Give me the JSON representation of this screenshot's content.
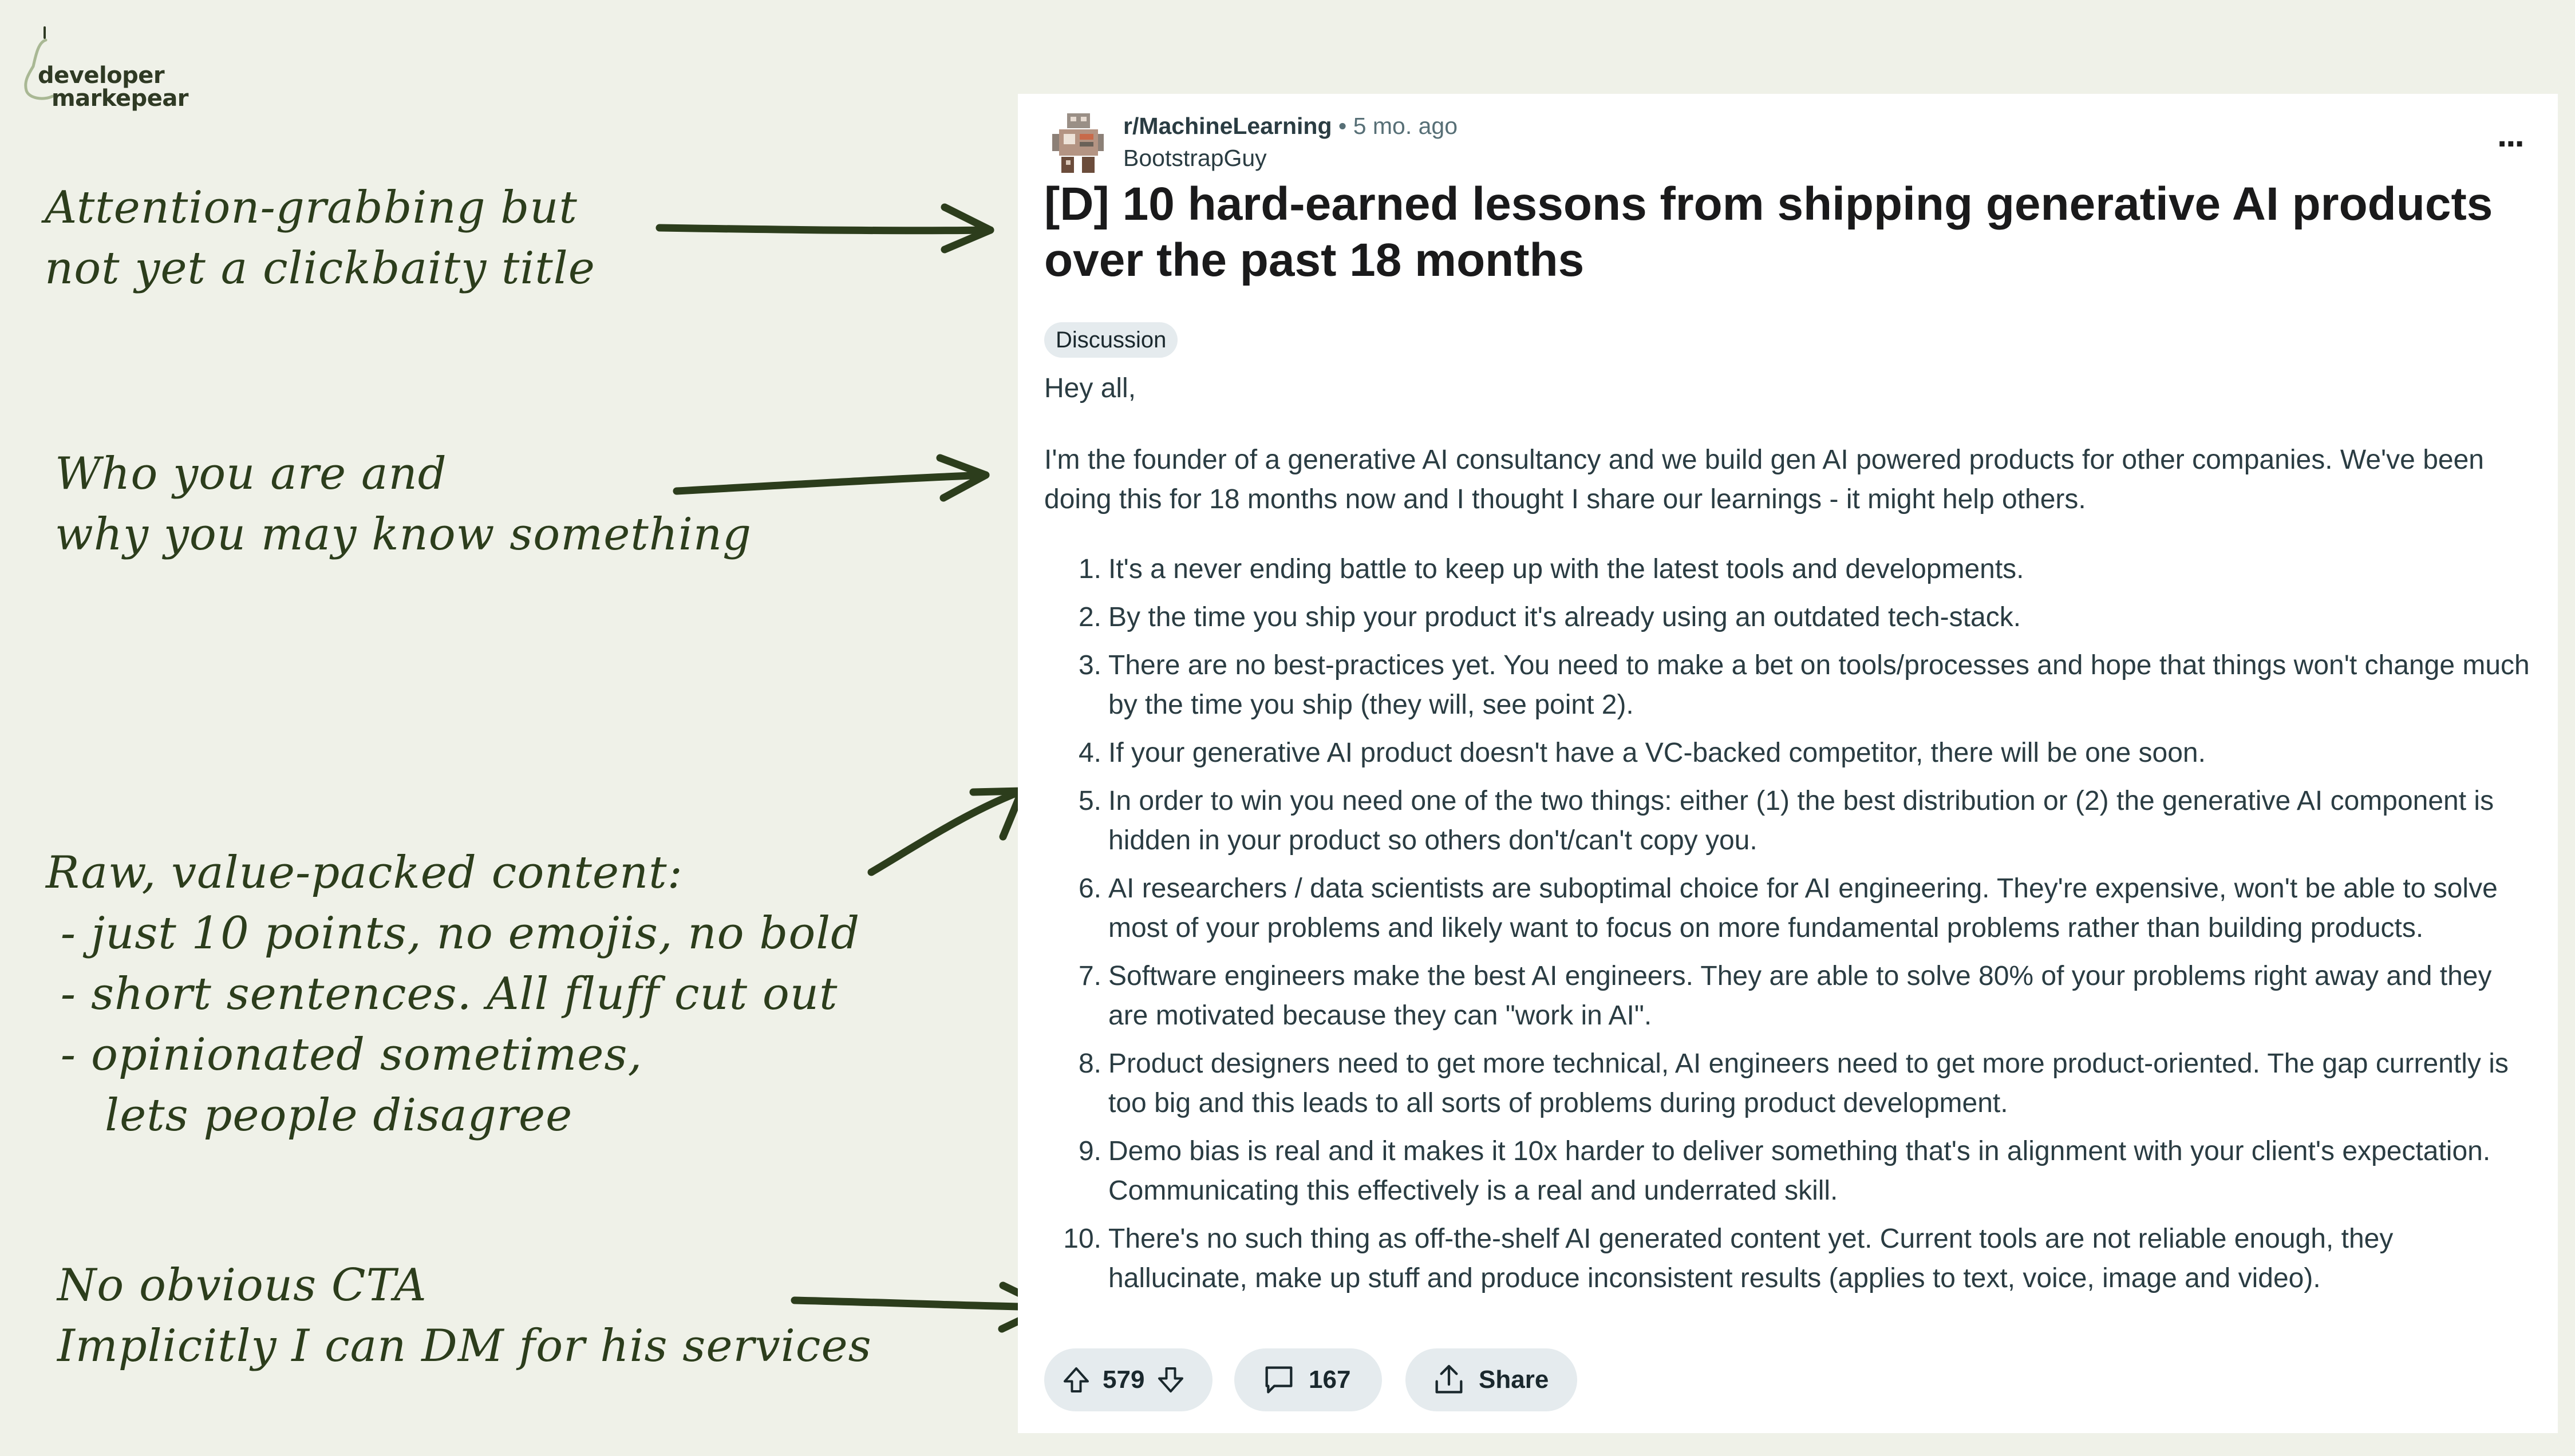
{
  "logo": {
    "line1": "developer",
    "line2": "markepear"
  },
  "annotations": {
    "title_note": "Attention-grabbing but\nnot yet a clickbaity title",
    "intro_note": "Who you are and\nwhy you may know something",
    "content_note": "Raw, value-packed content:\n - just 10 points, no emojis, no bold\n - short sentences. All fluff cut out\n - opinionated sometimes,\n    lets people disagree",
    "cta_note": "No obvious CTA\nImplicitly I can DM for his services"
  },
  "colors": {
    "background": "#eff1e8",
    "ink": "#2c3d1c",
    "card": "#ffffff",
    "pill": "#e5ebee"
  },
  "post": {
    "subreddit": "r/MachineLearning",
    "separator": "•",
    "age": "5 mo. ago",
    "author": "BootstrapGuy",
    "more_label": "...",
    "title": "[D] 10 hard-earned lessons from shipping generative AI products over the past 18 months",
    "flair": "Discussion",
    "greeting": "Hey all,",
    "intro": "I'm the founder of a generative AI consultancy and we build gen AI powered products for other companies. We've been doing this for 18 months now and I thought I share our learnings - it might help others.",
    "lessons": [
      {
        "num": "1.",
        "text": "It's a never ending battle to keep up with the latest tools and developments."
      },
      {
        "num": "2.",
        "text": "By the time you ship your product it's already using an outdated tech-stack."
      },
      {
        "num": "3.",
        "text": "There are no best-practices yet. You need to make a bet on tools/processes and hope that things won't change much by the time you ship (they will, see point 2)."
      },
      {
        "num": "4.",
        "text": "If your generative AI product doesn't have a VC-backed competitor, there will be one soon."
      },
      {
        "num": "5.",
        "text": "In order to win you need one of the two things: either (1) the best distribution or (2) the generative AI component is hidden in your product so others don't/can't copy you."
      },
      {
        "num": "6.",
        "text": "AI researchers / data scientists are suboptimal choice for AI engineering. They're expensive, won't be able to solve most of your problems and likely want to focus on more fundamental problems rather than building products."
      },
      {
        "num": "7.",
        "text": "Software engineers make the best AI engineers. They are able to solve 80% of your problems right away and they are motivated because they can \"work in AI\"."
      },
      {
        "num": "8.",
        "text": "Product designers need to get more technical, AI engineers need to get more product-oriented. The gap currently is too big and this leads to all sorts of problems during product development."
      },
      {
        "num": "9.",
        "text": "Demo bias is real and it makes it 10x harder to deliver something that's in alignment with your client's expectation. Communicating this effectively is a real and underrated skill."
      },
      {
        "num": "10.",
        "text": "There's no such thing as off-the-shelf AI generated content yet. Current tools are not reliable enough, they hallucinate, make up stuff and produce inconsistent results (applies to text, voice, image and video)."
      }
    ],
    "votes": "579",
    "comments": "167",
    "share_label": "Share"
  }
}
